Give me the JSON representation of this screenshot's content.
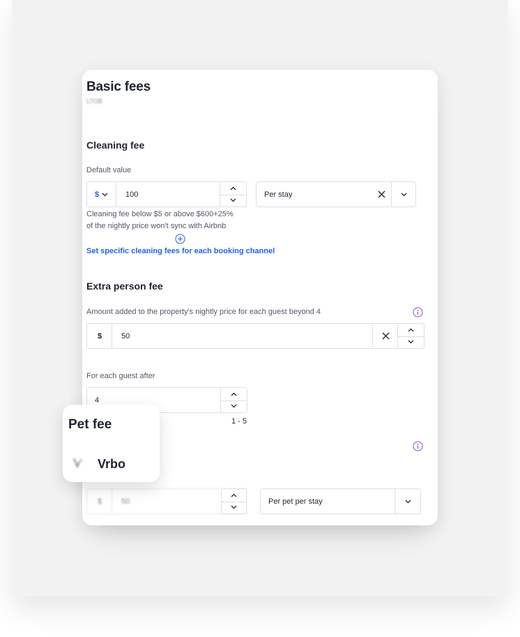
{
  "card": {
    "title": "Basic fees",
    "subtitle_blurred": "LTOB"
  },
  "cleaning": {
    "heading": "Cleaning fee",
    "label": "Default value",
    "currency": "$",
    "value": "100",
    "frequency": "Per stay",
    "help_line1": "Cleaning fee below $5 or above $600+25%",
    "help_line2": "of the nightly price won't sync with Airbnb",
    "channel_link": "Set specific cleaning fees for each booking channel"
  },
  "extra_person": {
    "heading": "Extra person fee",
    "description": "Amount added to the property's nightly price for each guest beyond 4",
    "currency": "$",
    "value": "50",
    "guest_label": "For each guest after",
    "guest_value": "4",
    "guest_range": "1 - 5"
  },
  "pet": {
    "currency": "$",
    "value": "50",
    "frequency": "Per pet per stay"
  },
  "popup": {
    "title": "Pet fee",
    "channel": "Vrbo"
  },
  "colors": {
    "link": "#2363e0",
    "info_icon": "#8a4fd1",
    "border": "#dcdfe5"
  },
  "icons": [
    "chevron-down-icon",
    "chevron-up-icon",
    "close-icon",
    "add-circle-icon",
    "info-icon",
    "vrbo-logo-icon"
  ]
}
